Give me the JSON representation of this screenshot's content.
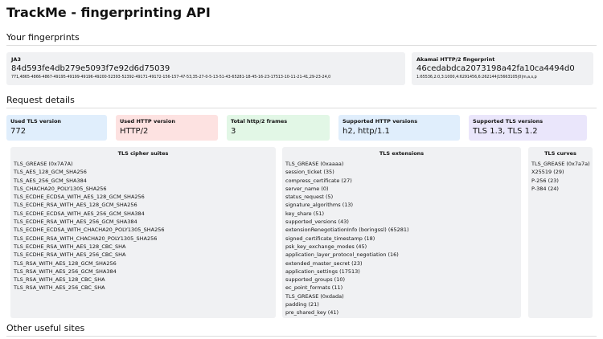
{
  "title": "TrackMe - fingerprinting API",
  "fingerprints": {
    "heading": "Your fingerprints",
    "ja3": {
      "label": "JA3",
      "hash": "84d593fe4db279e5093f7e92d6d75039",
      "full": "771,4865-4866-4867-49195-49199-49196-49200-52393-52392-49171-49172-156-157-47-53,35-27-0-5-13-51-43-65281-18-45-16-23-17513-10-11-21-41,29-23-24,0"
    },
    "akamai": {
      "label": "Akamai HTTP/2 fingerprint",
      "hash": "46cedabdca2073198a42fa10ca4494d0",
      "full": "1:65536,2:0,3:1000,4:6291456,6:262144|15663105|0|m,a,s,p"
    }
  },
  "request": {
    "heading": "Request details",
    "stats": [
      {
        "label": "Used TLS version",
        "value": "772",
        "color": "#e0eefc"
      },
      {
        "label": "Used HTTP version",
        "value": "HTTP/2",
        "color": "#fde2e1"
      },
      {
        "label": "Total http/2 frames",
        "value": "3",
        "color": "#e2f7e6"
      },
      {
        "label": "Supported HTTP versions",
        "value": "h2, http/1.1",
        "color": "#e0eefc"
      },
      {
        "label": "Supported TLS versions",
        "value": "TLS 1.3, TLS 1.2",
        "color": "#eae6fb"
      }
    ],
    "cipher_suites": {
      "title": "TLS cipher suites",
      "items": [
        "TLS_GREASE (0x7A7A)",
        "TLS_AES_128_GCM_SHA256",
        "TLS_AES_256_GCM_SHA384",
        "TLS_CHACHA20_POLY1305_SHA256",
        "TLS_ECDHE_ECDSA_WITH_AES_128_GCM_SHA256",
        "TLS_ECDHE_RSA_WITH_AES_128_GCM_SHA256",
        "TLS_ECDHE_ECDSA_WITH_AES_256_GCM_SHA384",
        "TLS_ECDHE_RSA_WITH_AES_256_GCM_SHA384",
        "TLS_ECDHE_ECDSA_WITH_CHACHA20_POLY1305_SHA256",
        "TLS_ECDHE_RSA_WITH_CHACHA20_POLY1305_SHA256",
        "TLS_ECDHE_RSA_WITH_AES_128_CBC_SHA",
        "TLS_ECDHE_RSA_WITH_AES_256_CBC_SHA",
        "TLS_RSA_WITH_AES_128_GCM_SHA256",
        "TLS_RSA_WITH_AES_256_GCM_SHA384",
        "TLS_RSA_WITH_AES_128_CBC_SHA",
        "TLS_RSA_WITH_AES_256_CBC_SHA"
      ]
    },
    "extensions": {
      "title": "TLS extensions",
      "items": [
        "TLS_GREASE (0xaaaa)",
        "session_ticket (35)",
        "compress_certificate (27)",
        "server_name (0)",
        "status_request (5)",
        "signature_algorithms (13)",
        "key_share (51)",
        "supported_versions (43)",
        "extensionRenegotiationInfo (boringssl) (65281)",
        "signed_certificate_timestamp (18)",
        "psk_key_exchange_modes (45)",
        "application_layer_protocol_negotiation (16)",
        "extended_master_secret (23)",
        "application_settings (17513)",
        "supported_groups (10)",
        "ec_point_formats (11)",
        "TLS_GREASE (0xdada)",
        "padding (21)",
        "pre_shared_key (41)"
      ]
    },
    "curves": {
      "title": "TLS curves",
      "items": [
        "TLS_GREASE (0x7a7a)",
        "X25519 (29)",
        "P-256 (23)",
        "P-384 (24)"
      ]
    }
  },
  "other": {
    "heading": "Other useful sites"
  }
}
